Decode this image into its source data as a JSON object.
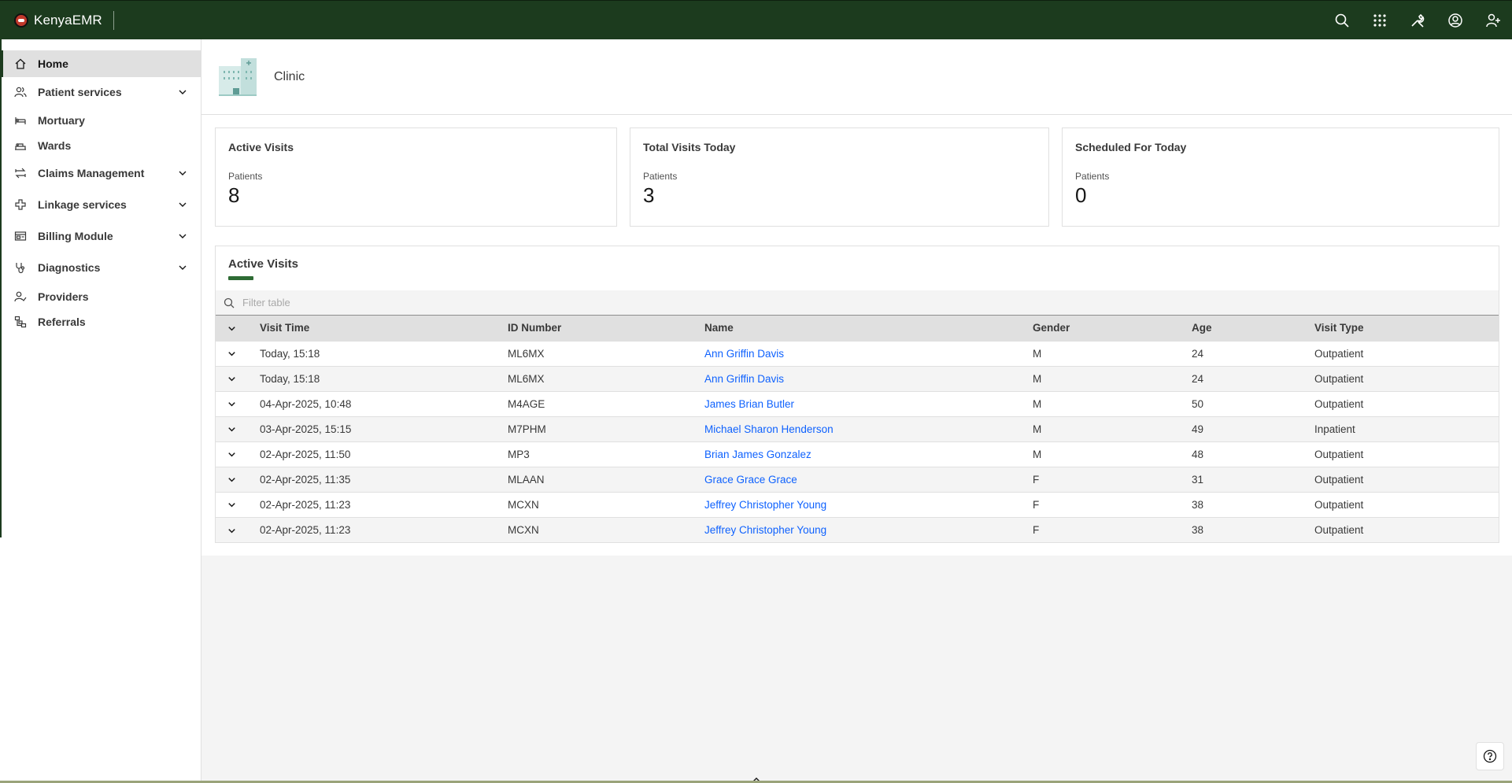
{
  "brand": {
    "name": "KenyaEMR"
  },
  "header_icons": [
    "search-icon",
    "app-switcher-icon",
    "tools-icon",
    "user-avatar-icon",
    "add-patient-icon"
  ],
  "sidebar": {
    "items": [
      {
        "label": "Home",
        "icon": "home-icon",
        "active": true,
        "expandable": false
      },
      {
        "label": "Patient services",
        "icon": "users-icon",
        "expandable": true
      },
      {
        "label": "Mortuary",
        "icon": "bed-icon",
        "expandable": false
      },
      {
        "label": "Wards",
        "icon": "hospital-bed-icon",
        "expandable": false
      },
      {
        "label": "Claims Management",
        "icon": "arrows-icon",
        "expandable": true
      },
      {
        "label": "Linkage services",
        "icon": "plus-icon",
        "expandable": true
      },
      {
        "label": "Billing Module",
        "icon": "billing-icon",
        "expandable": true
      },
      {
        "label": "Diagnostics",
        "icon": "stethoscope-icon",
        "expandable": true
      },
      {
        "label": "Providers",
        "icon": "user-check-icon",
        "expandable": false
      },
      {
        "label": "Referrals",
        "icon": "hierarchy-icon",
        "expandable": false
      }
    ]
  },
  "clinic": {
    "name": "Clinic"
  },
  "cards": [
    {
      "title": "Active Visits",
      "sub": "Patients",
      "value": "8"
    },
    {
      "title": "Total Visits Today",
      "sub": "Patients",
      "value": "3"
    },
    {
      "title": "Scheduled For Today",
      "sub": "Patients",
      "value": "0"
    }
  ],
  "active_visits": {
    "title": "Active Visits",
    "filter_placeholder": "Filter table",
    "columns": [
      "Visit Time",
      "ID Number",
      "Name",
      "Gender",
      "Age",
      "Visit Type"
    ],
    "rows": [
      {
        "time": "Today, 15:18",
        "id": "ML6MX",
        "name": "Ann Griffin Davis",
        "gender": "M",
        "age": "24",
        "type": "Outpatient"
      },
      {
        "time": "Today, 15:18",
        "id": "ML6MX",
        "name": "Ann Griffin Davis",
        "gender": "M",
        "age": "24",
        "type": "Outpatient"
      },
      {
        "time": "04-Apr-2025, 10:48",
        "id": "M4AGE",
        "name": "James Brian Butler",
        "gender": "M",
        "age": "50",
        "type": "Outpatient"
      },
      {
        "time": "03-Apr-2025, 15:15",
        "id": "M7PHM",
        "name": "Michael Sharon Henderson",
        "gender": "M",
        "age": "49",
        "type": "Inpatient"
      },
      {
        "time": "02-Apr-2025, 11:50",
        "id": "MP3",
        "name": "Brian James Gonzalez",
        "gender": "M",
        "age": "48",
        "type": "Outpatient"
      },
      {
        "time": "02-Apr-2025, 11:35",
        "id": "MLAAN",
        "name": "Grace Grace Grace",
        "gender": "F",
        "age": "31",
        "type": "Outpatient"
      },
      {
        "time": "02-Apr-2025, 11:23",
        "id": "MCXN",
        "name": "Jeffrey Christopher Young",
        "gender": "F",
        "age": "38",
        "type": "Outpatient"
      },
      {
        "time": "02-Apr-2025, 11:23",
        "id": "MCXN",
        "name": "Jeffrey Christopher Young",
        "gender": "F",
        "age": "38",
        "type": "Outpatient"
      }
    ]
  },
  "colors": {
    "header": "#1c3b1e",
    "accent": "#2e6b34",
    "link": "#0f62fe"
  }
}
